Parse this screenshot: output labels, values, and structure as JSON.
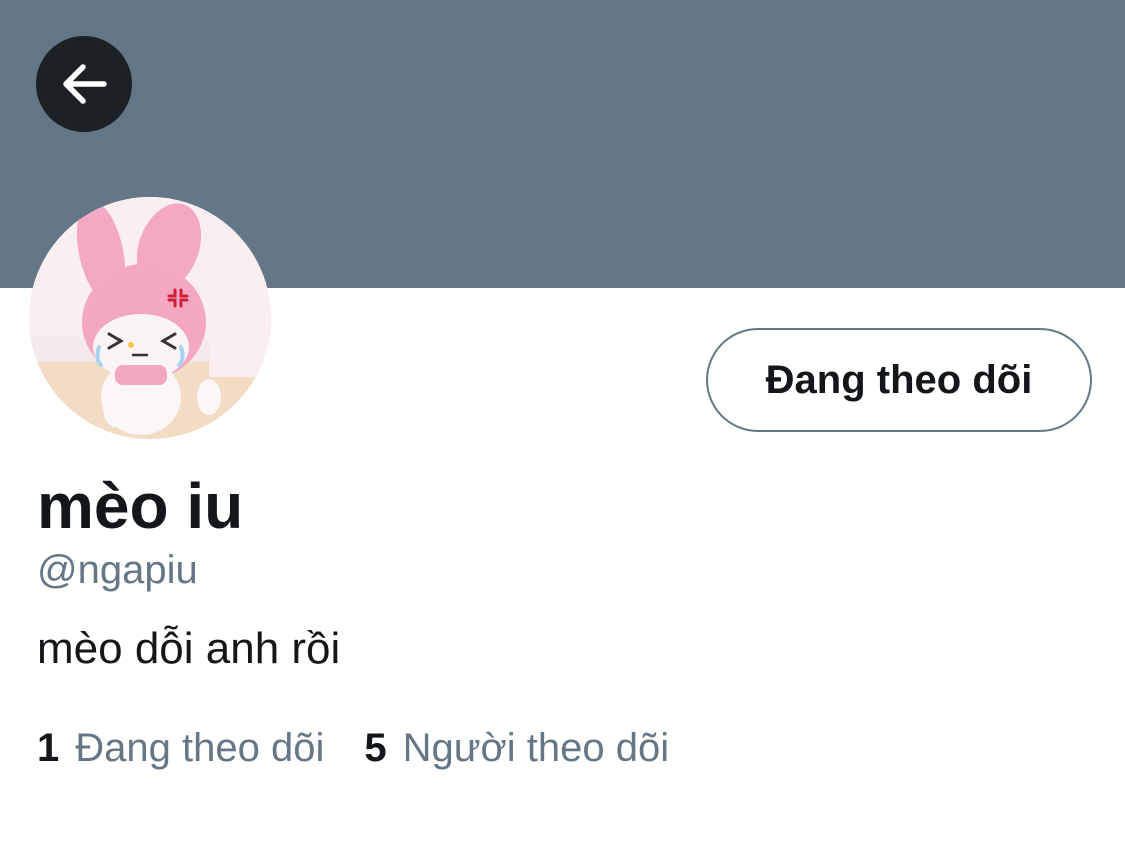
{
  "header": {
    "back_icon": "arrow-left-icon",
    "banner_color": "#657786"
  },
  "profile": {
    "avatar": "profile-avatar-image",
    "display_name": "mèo iu",
    "handle": "@ngapiu",
    "bio": "mèo dỗi anh rồi",
    "follow_button_label": "Đang theo dõi"
  },
  "stats": {
    "following_count": "1",
    "following_label": "Đang theo dõi",
    "followers_count": "5",
    "followers_label": "Người theo dõi"
  },
  "colors": {
    "text_primary": "#14171a",
    "text_secondary": "#657786",
    "back_button_bg": "#1c2126"
  }
}
